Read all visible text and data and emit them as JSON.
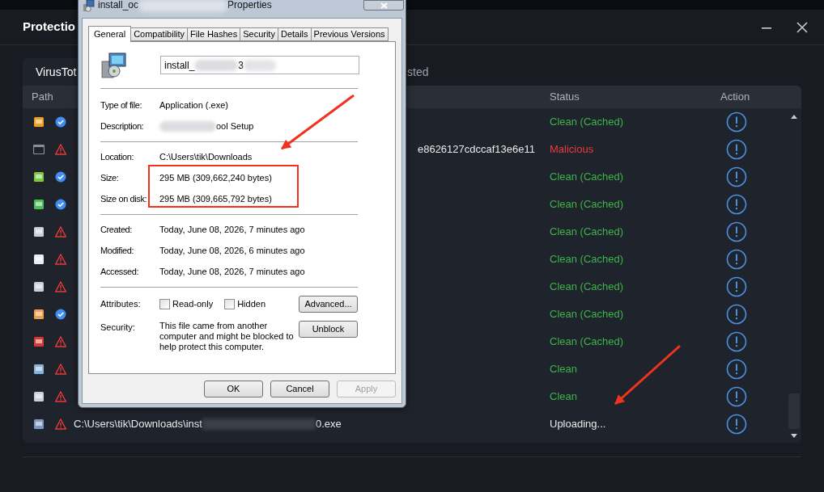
{
  "app": {
    "title": "Protectio",
    "tabs": [
      {
        "label": "VirusTot",
        "selected": true
      },
      {
        "label": "sted",
        "selected": false
      }
    ],
    "table": {
      "columns": [
        "Path",
        "Status",
        "Action"
      ],
      "rows": [
        {
          "trusted": true,
          "status": "Clean (Cached)",
          "kind": "clean"
        },
        {
          "trusted": false,
          "path_fragment": "e8626127cdccaf13e6e11",
          "status": "Malicious",
          "kind": "malicious"
        },
        {
          "trusted": true,
          "status": "Clean (Cached)",
          "kind": "clean"
        },
        {
          "trusted": true,
          "status": "Clean (Cached)",
          "kind": "clean"
        },
        {
          "trusted": false,
          "status": "Clean (Cached)",
          "kind": "clean"
        },
        {
          "trusted": false,
          "status": "Clean (Cached)",
          "kind": "clean"
        },
        {
          "trusted": false,
          "status": "Clean (Cached)",
          "kind": "clean"
        },
        {
          "trusted": true,
          "status": "Clean (Cached)",
          "kind": "clean"
        },
        {
          "trusted": false,
          "status": "Clean (Cached)",
          "kind": "clean"
        },
        {
          "trusted": false,
          "status": "Clean",
          "kind": "clean"
        },
        {
          "trusted": false,
          "status": "Clean",
          "kind": "clean"
        },
        {
          "trusted": false,
          "path_parts": [
            "C:\\Users\\tik\\Downloads\\inst",
            "0.exe"
          ],
          "status": "Uploading...",
          "kind": "pending"
        }
      ]
    }
  },
  "dialog": {
    "title_parts": [
      "install_oc",
      "Properties"
    ],
    "tabs": [
      {
        "label": "General",
        "selected": true
      },
      {
        "label": "Compatibility",
        "selected": false
      },
      {
        "label": "File Hashes",
        "selected": false
      },
      {
        "label": "Security",
        "selected": false
      },
      {
        "label": "Details",
        "selected": false
      },
      {
        "label": "Previous Versions",
        "selected": false
      }
    ],
    "file_name_parts": [
      "install_",
      "3"
    ],
    "groups": [
      [
        {
          "label": "Type of file:",
          "value": "Application (.exe)"
        },
        {
          "label": "Description:",
          "value": "ool Setup",
          "redacted": true
        }
      ],
      [
        {
          "label": "Location:",
          "value": "C:\\Users\\tik\\Downloads"
        },
        {
          "label": "Size:",
          "value": "295 MB (309,662,240 bytes)"
        },
        {
          "label": "Size on disk:",
          "value": "295 MB (309,665,792 bytes)"
        }
      ],
      [
        {
          "label": "Created:",
          "value": "Today, June 08, 2026, 7 minutes ago"
        },
        {
          "label": "Modified:",
          "value": "Today, June 08, 2026, 6 minutes ago"
        },
        {
          "label": "Accessed:",
          "value": "Today, June 08, 2026, 7 minutes ago"
        }
      ]
    ],
    "attributes": {
      "label": "Attributes:",
      "checkboxes": [
        {
          "label": "Read-only",
          "checked": false
        },
        {
          "label": "Hidden",
          "checked": false
        }
      ],
      "button": "Advanced..."
    },
    "security": {
      "label": "Security:",
      "text": "This file came from another computer and might be blocked to help protect this computer.",
      "button": "Unblock"
    },
    "buttons": [
      {
        "label": "OK",
        "disabled": false
      },
      {
        "label": "Cancel",
        "disabled": false
      },
      {
        "label": "Apply",
        "disabled": true
      }
    ]
  }
}
